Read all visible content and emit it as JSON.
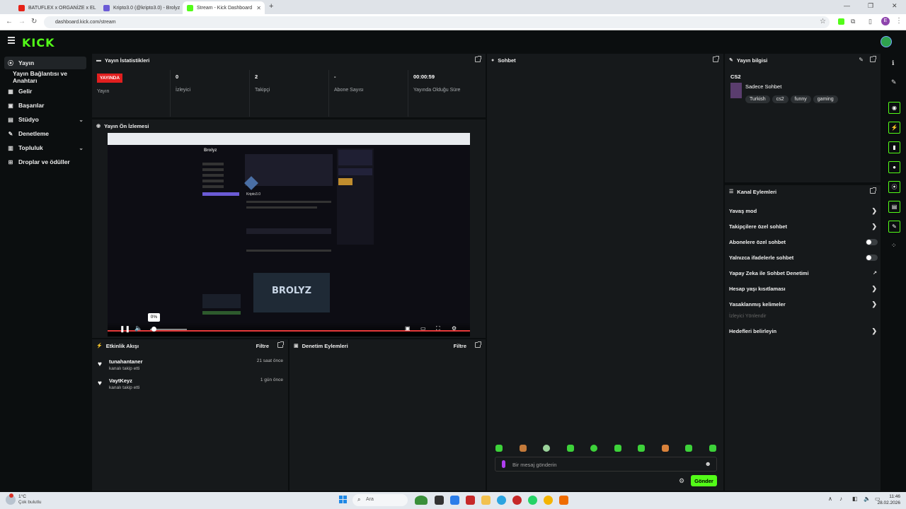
{
  "browser": {
    "tabs": [
      {
        "title": "BATUFLEX x ORGANİZE x EL",
        "color": "#e62117",
        "active": false
      },
      {
        "title": "Kripto3.0 (@kripto3.0) - Brolyz",
        "color": "#6b5bd6",
        "active": false
      },
      {
        "title": "Stream - Kick Dashboard",
        "color": "#53fc18",
        "active": true
      }
    ],
    "url": "dashboard.kick.com/stream",
    "profile_letter": "E"
  },
  "app": {
    "logo": "KICK",
    "accent": "#53fc18"
  },
  "sidebar": {
    "items": [
      {
        "label": "Yayın",
        "icon": "broadcast-icon",
        "glyph": "((·))",
        "active": true
      },
      {
        "label": "Yayın Bağlantısı ve Anahtarı",
        "icon": "key-icon",
        "glyph": "",
        "active": false
      },
      {
        "label": "Gelir",
        "icon": "revenue-icon",
        "glyph": "▦",
        "active": false
      },
      {
        "label": "Başarılar",
        "icon": "trophy-icon",
        "glyph": "▣",
        "active": false
      },
      {
        "label": "Stüdyo",
        "icon": "studio-icon",
        "glyph": "▤",
        "active": false,
        "expandable": true
      },
      {
        "label": "Denetleme",
        "icon": "wrench-icon",
        "glyph": "✎",
        "active": false
      },
      {
        "label": "Topluluk",
        "icon": "community-icon",
        "glyph": "▥",
        "active": false,
        "expandable": true
      },
      {
        "label": "Droplar ve ödüller",
        "icon": "gift-icon",
        "glyph": "⊞",
        "active": false
      }
    ]
  },
  "stats": {
    "title": "Yayın İstatistikleri",
    "live_badge": "YAYINDA",
    "live_label": "Yayın",
    "items": [
      {
        "value": "0",
        "label": "İzleyici"
      },
      {
        "value": "2",
        "label": "Takipçi"
      },
      {
        "value": "-",
        "label": "Abone Sayısı"
      },
      {
        "value": "00:00:59",
        "label": "Yayında Olduğu Süre"
      }
    ]
  },
  "preview": {
    "title": "Yayın Ön İzlemesi",
    "volume_tooltip": "0%",
    "inner_brand": "Brolyz",
    "inner_banner": "BROLYZ",
    "inner_user": "Kripto3.0"
  },
  "activity": {
    "title": "Etkinlik Akışı",
    "filter_label": "Filtre",
    "events": [
      {
        "user": "tunahantaner",
        "action": "kanalı takip etti",
        "time": "21 saat önce"
      },
      {
        "user": "VaytKeyz",
        "action": "kanalı takip etti",
        "time": "1 gün önce"
      }
    ]
  },
  "moderation": {
    "title": "Denetim Eylemleri",
    "filter_label": "Filtre"
  },
  "chat": {
    "title": "Sohbet",
    "placeholder": "Bir mesaj gönderin",
    "send_label": "Gönder",
    "emote_count": 10
  },
  "stream_info": {
    "title": "Yayın bilgisi",
    "category": "CS2",
    "stream_title": "Sadece Sohbet",
    "tags": [
      "Turkish",
      "cs2",
      "funny",
      "gaming"
    ]
  },
  "channel_actions": {
    "title": "Kanal Eylemleri",
    "items": [
      {
        "label": "Yavaş mod",
        "control": "chevron"
      },
      {
        "label": "Takipçilere özel sohbet",
        "control": "chevron"
      },
      {
        "label": "Abonelere özel sohbet",
        "control": "toggle",
        "on": false
      },
      {
        "label": "Yalnızca ifadelerle sohbet",
        "control": "toggle",
        "on": false
      },
      {
        "label": "Yapay Zeka ile Sohbet Denetimi",
        "control": "external"
      },
      {
        "label": "Hesap yaşı kısıtlaması",
        "control": "chevron"
      },
      {
        "label": "Yasaklanmış kelimeler",
        "control": "chevron"
      }
    ],
    "section_label": "İzleyici Yönlendir",
    "section_items": [
      {
        "label": "Hedefleri belirleyin",
        "control": "chevron"
      }
    ]
  },
  "taskbar": {
    "weather_temp": "1°C",
    "weather_desc": "Çok bulutlu",
    "search_placeholder": "Ara",
    "time": "11:46",
    "date": "28.02.2026"
  }
}
